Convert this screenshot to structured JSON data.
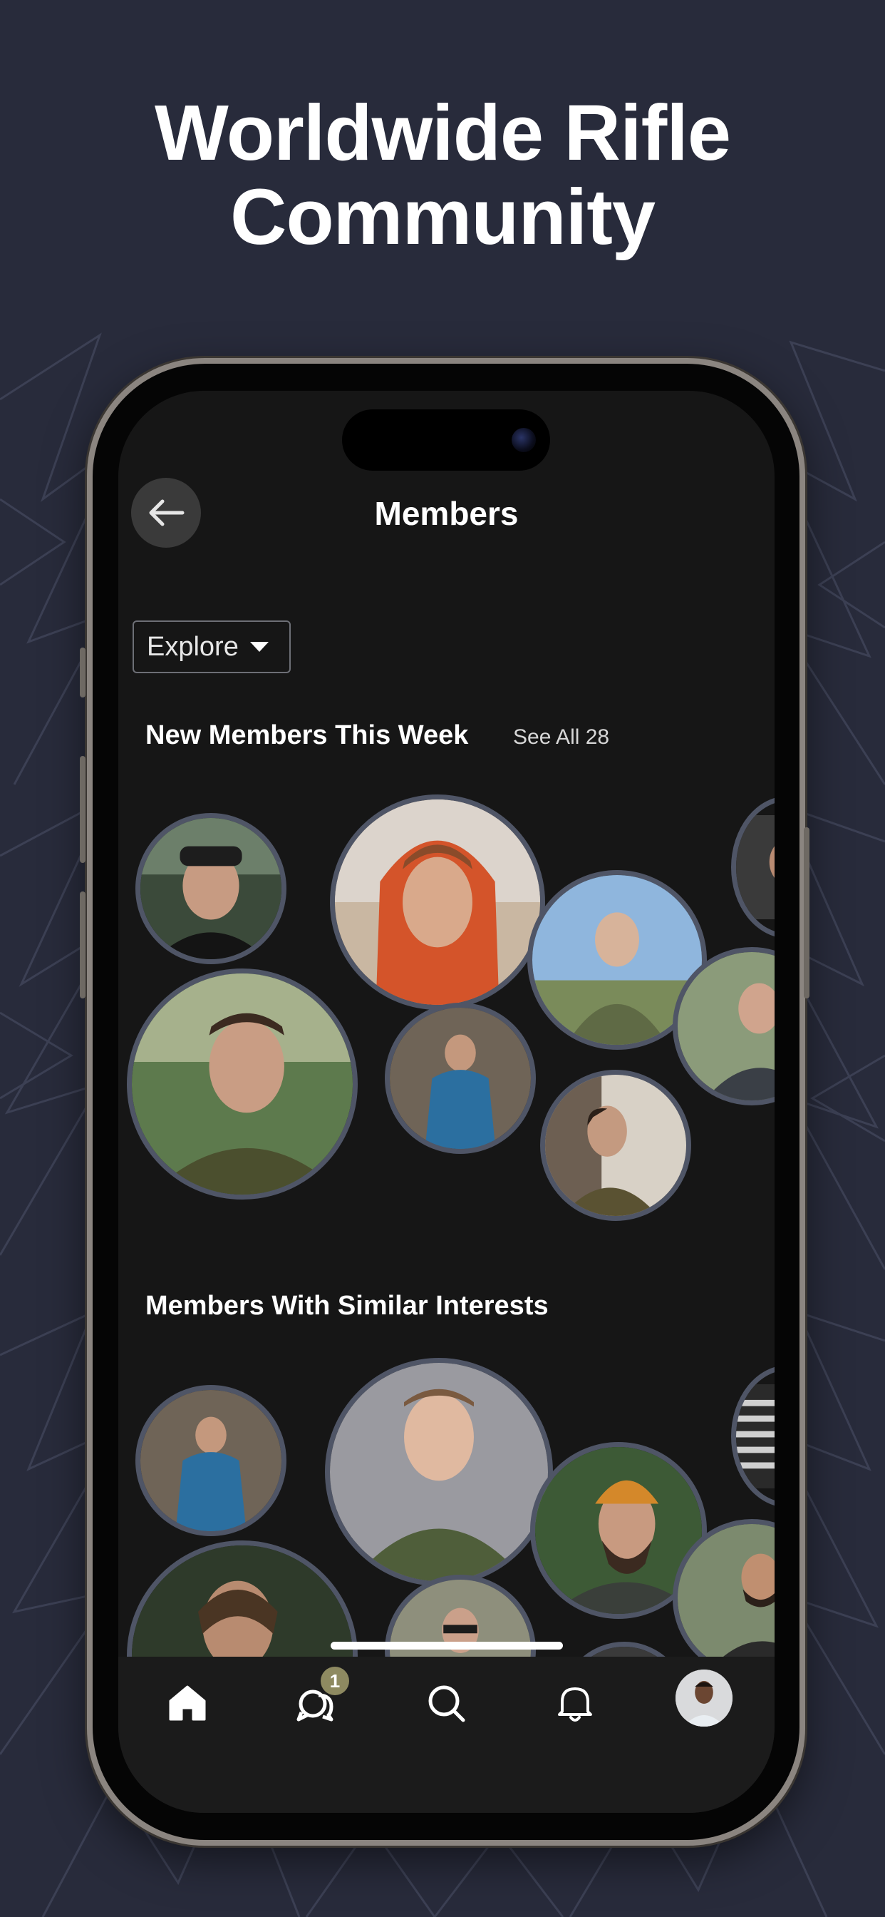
{
  "headline": {
    "line1": "Worldwide Rifle",
    "line2": "Community"
  },
  "screen": {
    "title": "Members"
  },
  "filter": {
    "label": "Explore"
  },
  "sections": {
    "new_members": {
      "title": "New Members This Week",
      "see_all": "See All 28"
    },
    "similar": {
      "title": "Members With Similar Interests"
    }
  },
  "tabbar": {
    "chat_badge": "1"
  },
  "colors": {
    "background": "#282b3b",
    "screen": "#161616",
    "avatar_ring": "#4f5566",
    "badge": "#8e8a61"
  },
  "icons": {
    "back": "arrow-left-icon",
    "home": "home-icon",
    "chat": "chat-bubbles-icon",
    "search": "search-icon",
    "bell": "bell-icon",
    "profile": "profile-avatar"
  }
}
